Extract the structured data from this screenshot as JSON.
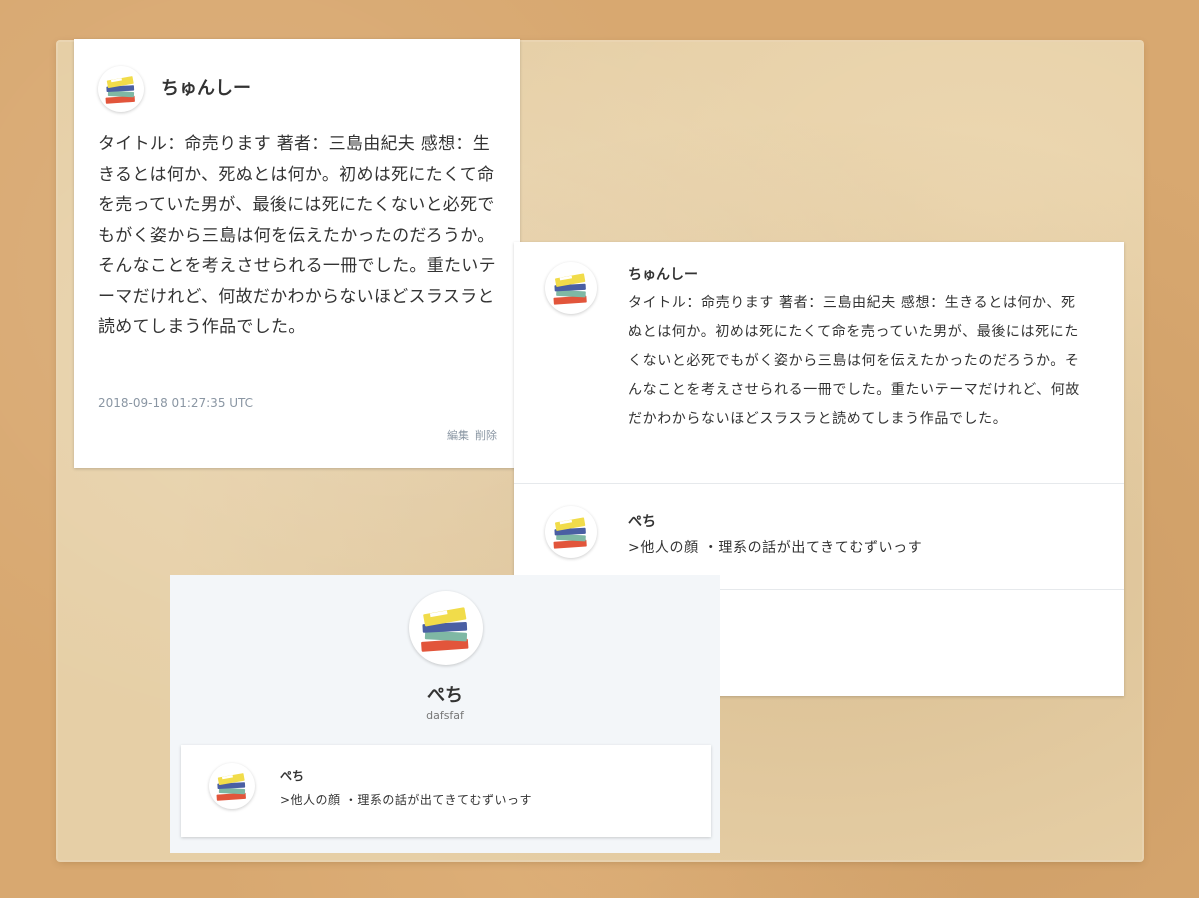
{
  "card1": {
    "author": "ちゅんしー",
    "text": "タイトル：命売ります 著者：三島由紀夫 感想：生きるとは何か、死ぬとは何か。初めは死にたくて命を売っていた男が、最後には死にたくないと必死でもがく姿から三島は何を伝えたかったのだろうか。そんなことを考えさせられる一冊でした。重たいテーマだけれど、何故だかわからないほどスラスラと読めてしまう作品でした。",
    "timestamp": "2018-09-18 01:27:35 UTC",
    "edit_label": "編集",
    "delete_label": "削除"
  },
  "card2": {
    "comments": [
      {
        "author": "ちゅんしー",
        "text": "タイトル：命売ります 著者：三島由紀夫 感想：生きるとは何か、死ぬとは何か。初めは死にたくて命を売っていた男が、最後には死にたくないと必死でもがく姿から三島は何を伝えたかったのだろうか。そんなことを考えさせられる一冊でした。重たいテーマだけれど、何故だかわからないほどスラスラと読めてしまう作品でした。"
      },
      {
        "author": "ぺち",
        "text": ">他人の顔 ・理系の話が出てきてむずいっす"
      }
    ]
  },
  "card3": {
    "profile_name": "ぺち",
    "profile_id": "dafsfaf",
    "comment": {
      "author": "ぺち",
      "text": ">他人の顔 ・理系の話が出てきてむずいっす"
    }
  },
  "icons": {
    "avatar": "books-stack-icon"
  },
  "colors": {
    "muted": "#8a96a3",
    "profile_bg": "#f3f6f9",
    "text": "#333333"
  }
}
